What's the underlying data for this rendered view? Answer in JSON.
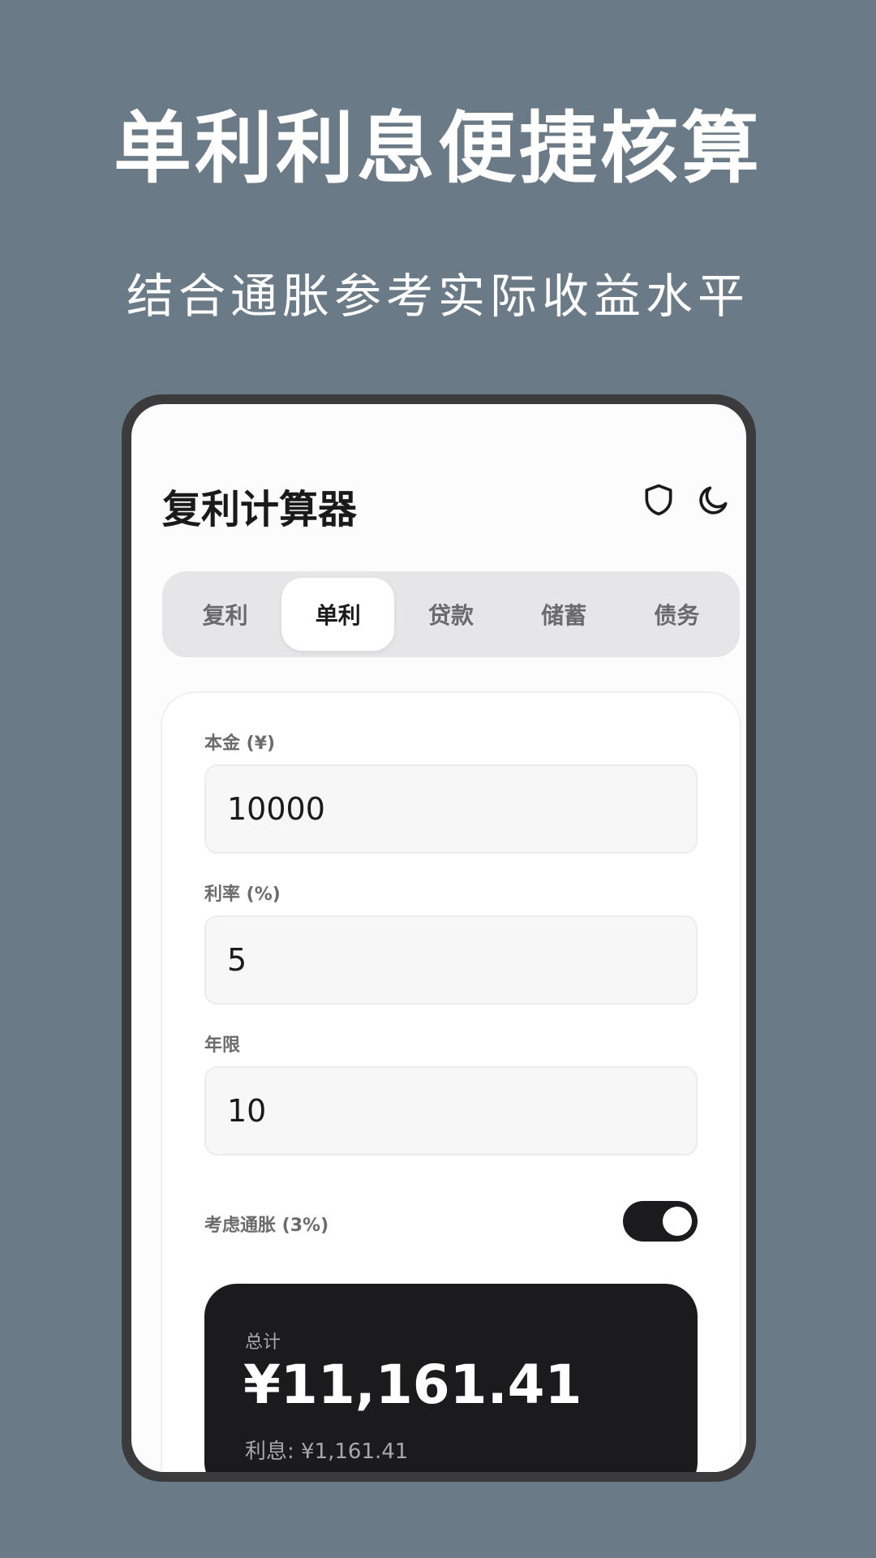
{
  "promo": {
    "title": "单利利息便捷核算",
    "subtitle": "结合通胀参考实际收益水平"
  },
  "header": {
    "title": "复利计算器",
    "icons": [
      "shield-icon",
      "moon-icon"
    ]
  },
  "tabs": [
    {
      "label": "复利",
      "active": false
    },
    {
      "label": "单利",
      "active": true
    },
    {
      "label": "贷款",
      "active": false
    },
    {
      "label": "储蓄",
      "active": false
    },
    {
      "label": "债务",
      "active": false
    }
  ],
  "form": {
    "principal": {
      "label": "本金 (¥)",
      "value": "10000"
    },
    "rate": {
      "label": "利率 (%)",
      "value": "5"
    },
    "years": {
      "label": "年限",
      "value": "10"
    },
    "inflation": {
      "label": "考虑通胀 (3%)",
      "enabled": true
    }
  },
  "result": {
    "label": "总计",
    "total": "¥11,161.41",
    "interest": "利息: ¥1,161.41"
  },
  "colors": {
    "background": "#6a7a86",
    "accent": "#1b1b1d"
  }
}
